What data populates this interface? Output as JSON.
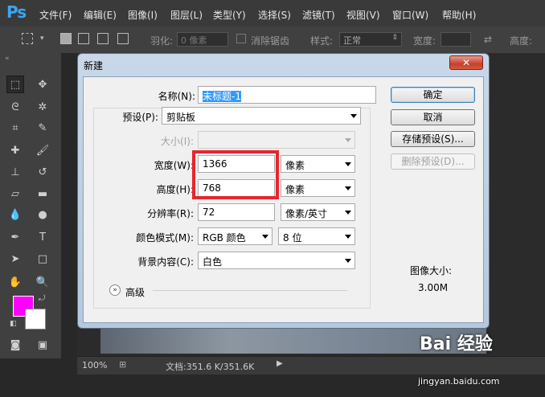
{
  "app": {
    "logo": "Ps"
  },
  "menu": [
    "文件(F)",
    "编辑(E)",
    "图像(I)",
    "图层(L)",
    "类型(Y)",
    "选择(S)",
    "滤镜(T)",
    "视图(V)",
    "窗口(W)",
    "帮助(H)"
  ],
  "options_bar": {
    "feather_label": "羽化:",
    "feather_value": "0 像素",
    "antialias_label": "消除锯齿",
    "style_label": "样式:",
    "style_value": "正常",
    "width_label": "宽度:",
    "height_label": "高度:"
  },
  "colors": {
    "foreground": "#ff00ff",
    "background": "#ffffff",
    "highlight": "#e8262c"
  },
  "dialog": {
    "title": "新建",
    "close_glyph": "✕",
    "name_label": "名称(N):",
    "name_value": "未标题-1",
    "preset_label": "预设(P):",
    "preset_value": "剪贴板",
    "size_label": "大小(I):",
    "width_label": "宽度(W):",
    "width_value": "1366",
    "width_unit": "像素",
    "height_label": "高度(H):",
    "height_value": "768",
    "height_unit": "像素",
    "resolution_label": "分辨率(R):",
    "resolution_value": "72",
    "resolution_unit": "像素/英寸",
    "color_mode_label": "颜色模式(M):",
    "color_mode_value": "RGB 颜色",
    "bit_depth_value": "8 位",
    "bg_content_label": "背景内容(C):",
    "bg_content_value": "白色",
    "advanced_label": "高级",
    "image_size_label": "图像大小:",
    "image_size_value": "3.00M",
    "buttons": {
      "ok": "确定",
      "cancel": "取消",
      "save_preset": "存储预设(S)...",
      "delete_preset": "删除预设(D)..."
    }
  },
  "status": {
    "zoom": "100%",
    "doc": "文档:351.6 K/351.6K"
  },
  "watermark": {
    "brand": "Bai 经验",
    "url": "jingyan.baidu.com"
  }
}
